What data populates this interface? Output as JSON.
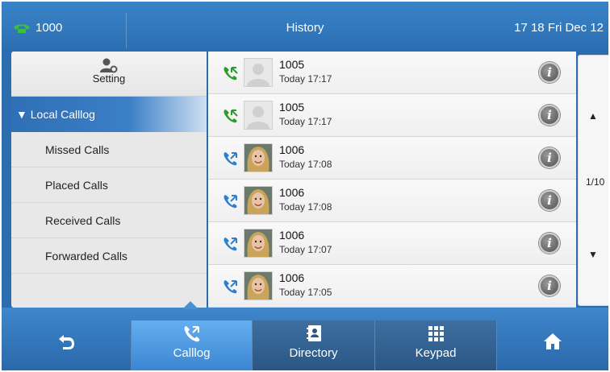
{
  "statusbar": {
    "account": "1000",
    "title": "History",
    "datetime": "17 18 Fri Dec 12"
  },
  "sidebar": {
    "setting_label": "Setting",
    "group_label": "▼ Local Calllog",
    "items": [
      {
        "label": "Missed Calls"
      },
      {
        "label": "Placed Calls"
      },
      {
        "label": "Received Calls"
      },
      {
        "label": "Forwarded Calls"
      }
    ]
  },
  "calls": [
    {
      "name": "1005",
      "time": "Today 17:17",
      "call_icon": "call-green-icon",
      "avatar": "default-avatar"
    },
    {
      "name": "1005",
      "time": "Today 17:17",
      "call_icon": "call-green-icon",
      "avatar": "default-avatar"
    },
    {
      "name": "1006",
      "time": "Today 17:08",
      "call_icon": "call-blue-icon",
      "avatar": "photo-avatar"
    },
    {
      "name": "1006",
      "time": "Today 17:08",
      "call_icon": "call-blue-icon",
      "avatar": "photo-avatar"
    },
    {
      "name": "1006",
      "time": "Today 17:07",
      "call_icon": "call-blue-icon",
      "avatar": "photo-avatar"
    },
    {
      "name": "1006",
      "time": "Today 17:05",
      "call_icon": "call-blue-icon",
      "avatar": "photo-avatar"
    }
  ],
  "info_glyph": "i",
  "pager": {
    "up": "▲",
    "page": "1/10",
    "down": "▼"
  },
  "softkeys": {
    "back_icon": "back-icon",
    "calllog_label": "Calllog",
    "directory_label": "Directory",
    "keypad_label": "Keypad",
    "home_icon": "home-icon"
  },
  "colors": {
    "accent": "#2b6fb2",
    "green_call": "#2e9a2e",
    "blue_call": "#2f7fcf"
  }
}
